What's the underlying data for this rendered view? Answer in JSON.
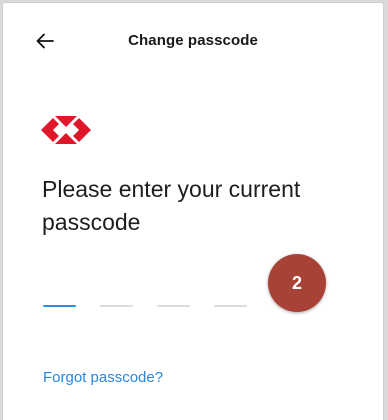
{
  "header": {
    "title": "Change passcode",
    "back_icon": "arrow-left-icon"
  },
  "logo": {
    "icon": "red-diamond-logo-icon",
    "color": "#e0162b"
  },
  "prompt": {
    "text": "Please enter your current passcode"
  },
  "passcode": {
    "digit_count": 4,
    "entered_count": 0,
    "active_color": "#2e8ee6",
    "inactive_color": "#dcdcdc"
  },
  "step_badge": {
    "label": "2",
    "color": "#a84236"
  },
  "footer": {
    "forgot_label": "Forgot passcode?",
    "link_color": "#2c86d9"
  }
}
